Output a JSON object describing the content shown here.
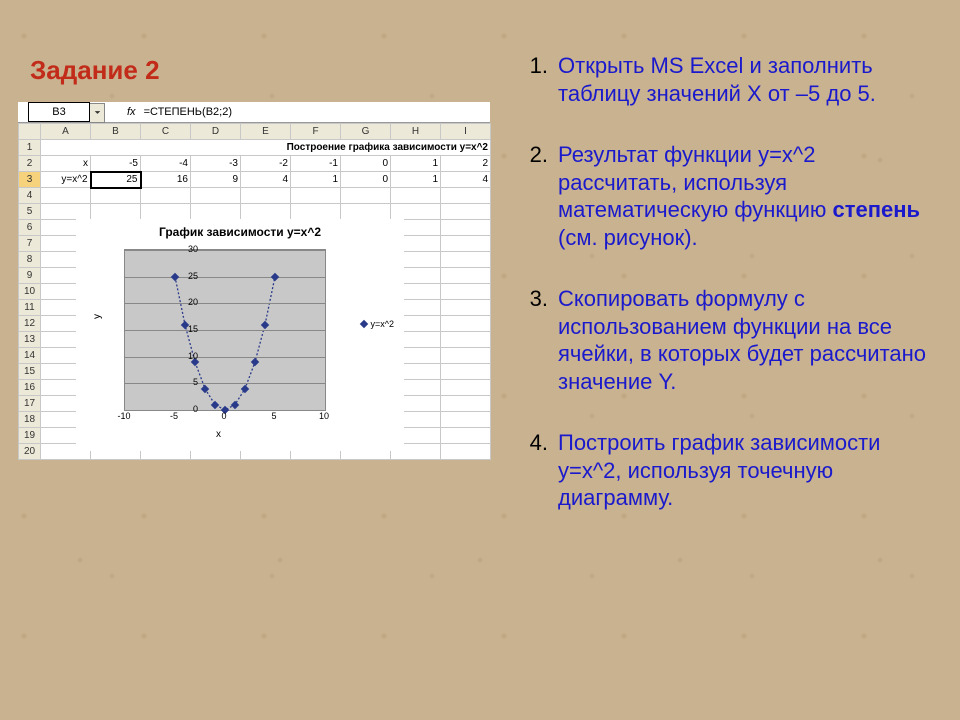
{
  "title": "Задание 2",
  "formula_bar": {
    "namebox": "B3",
    "fx_label": "fx",
    "formula": "=СТЕПЕНЬ(B2;2)"
  },
  "columns": [
    "A",
    "B",
    "C",
    "D",
    "E",
    "F",
    "G",
    "H",
    "I"
  ],
  "row1_label": "Построение графика зависимости y=x^2",
  "row2": {
    "label": "x",
    "cells": [
      "-5",
      "-4",
      "-3",
      "-2",
      "-1",
      "0",
      "1",
      "2"
    ]
  },
  "row3": {
    "label": "y=x^2",
    "cells": [
      "25",
      "16",
      "9",
      "4",
      "1",
      "0",
      "1",
      "4"
    ]
  },
  "row_numbers": [
    "1",
    "2",
    "3",
    "4",
    "5",
    "6",
    "7",
    "8",
    "9",
    "10",
    "11",
    "12",
    "13",
    "14",
    "15",
    "16",
    "17",
    "18",
    "19",
    "20"
  ],
  "chart_data": {
    "type": "scatter",
    "title": "График зависимости y=x^2",
    "xlabel": "x",
    "ylabel": "y",
    "xlim": [
      -10,
      10
    ],
    "ylim": [
      0,
      30
    ],
    "xticks": [
      -10,
      -5,
      0,
      5,
      10
    ],
    "yticks": [
      0,
      5,
      10,
      15,
      20,
      25,
      30
    ],
    "series": [
      {
        "name": "y=x^2",
        "x": [
          -5,
          -4,
          -3,
          -2,
          -1,
          0,
          1,
          2,
          3,
          4,
          5
        ],
        "y": [
          25,
          16,
          9,
          4,
          1,
          0,
          1,
          4,
          9,
          16,
          25
        ]
      }
    ]
  },
  "steps": [
    {
      "num": "1.",
      "text": " Открыть MS Excel и заполнить таблицу значений Х от –5 до 5."
    },
    {
      "num": "2.",
      "text_pre": " Результат функции y=x^2 рассчитать, используя математическую функцию ",
      "bold": "степень",
      "text_post": " (см. рисунок)."
    },
    {
      "num": "3.",
      "text": " Скопировать формулу с использованием функции на все ячейки, в которых будет рассчитано значение Y."
    },
    {
      "num": "4.",
      "text": "  Построить график зависимости y=x^2, используя точечную диаграмму."
    }
  ]
}
